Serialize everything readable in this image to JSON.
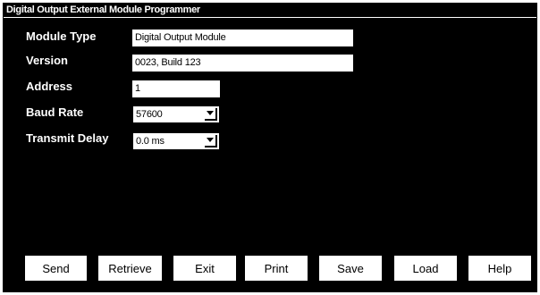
{
  "window": {
    "title": "Digital Output External Module Programmer"
  },
  "fields": {
    "module_type": {
      "label": "Module Type",
      "value": "Digital Output Module"
    },
    "version": {
      "label": "Version",
      "value": "0023, Build 123"
    },
    "address": {
      "label": "Address",
      "value": "1"
    },
    "baud_rate": {
      "label": "Baud Rate",
      "value": "57600"
    },
    "transmit_delay": {
      "label": "Transmit Delay",
      "value": "0.0 ms"
    }
  },
  "buttons": {
    "send": "Send",
    "retrieve": "Retrieve",
    "exit": "Exit",
    "print": "Print",
    "save": "Save",
    "load": "Load",
    "help": "Help"
  },
  "colors": {
    "background": "#000000",
    "foreground": "#ffffff"
  }
}
